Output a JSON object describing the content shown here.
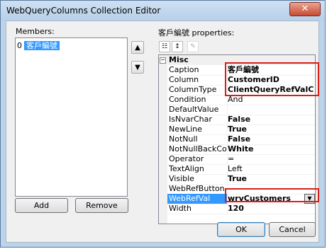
{
  "window": {
    "title": "WebQueryColumns Collection Editor",
    "close_glyph": "✕"
  },
  "members": {
    "label": "Members:",
    "items": [
      {
        "index": "0",
        "text": "客戶編號"
      }
    ]
  },
  "properties_label": "客戶編號 properties:",
  "grid": {
    "category": "Misc",
    "rows": [
      {
        "name": "Caption",
        "value": "客戶編號"
      },
      {
        "name": "Column",
        "value": "CustomerID"
      },
      {
        "name": "ColumnType",
        "value": "ClientQueryRefValColumn"
      },
      {
        "name": "Condition",
        "value": "And"
      },
      {
        "name": "DefaultValue",
        "value": ""
      },
      {
        "name": "IsNvarChar",
        "value": "False"
      },
      {
        "name": "NewLine",
        "value": "True"
      },
      {
        "name": "NotNull",
        "value": "False"
      },
      {
        "name": "NotNullBackColor",
        "value": "White"
      },
      {
        "name": "Operator",
        "value": "="
      },
      {
        "name": "TextAlign",
        "value": "Left"
      },
      {
        "name": "Visible",
        "value": "True"
      },
      {
        "name": "WebRefButton",
        "value": ""
      },
      {
        "name": "WebRefVal",
        "value": "wrvCustomers"
      },
      {
        "name": "Width",
        "value": "120"
      }
    ]
  },
  "buttons": {
    "add": "Add",
    "remove": "Remove",
    "ok": "OK",
    "cancel": "Cancel"
  },
  "colors": {
    "highlight_box": "#d91e18",
    "selection": "#3399ff"
  }
}
